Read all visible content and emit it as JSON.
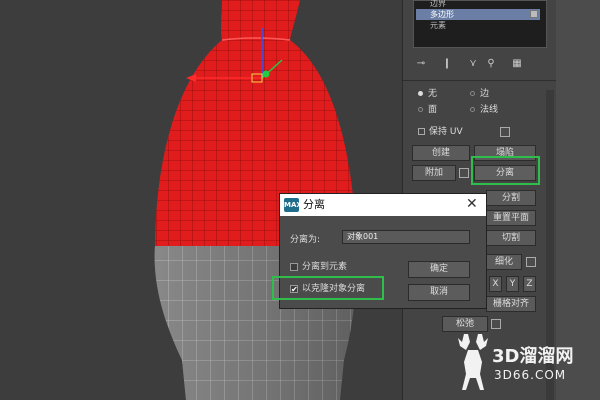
{
  "selection_list": {
    "items": [
      {
        "label": "边界"
      },
      {
        "label": "多边形",
        "active": true
      },
      {
        "label": "元素"
      }
    ]
  },
  "panel": {
    "radio_none": "无",
    "radio_edge": "边",
    "radio_face": "面",
    "radio_normal": "法线",
    "keep_uv": "保持 UV",
    "create": "创建",
    "collapse": "塌陷",
    "attach": "附加",
    "detach": "分离",
    "slice": "分割",
    "reset_plane": "重置平面",
    "cut": "切割",
    "refine": "细化",
    "axis_x": "X",
    "axis_y": "Y",
    "axis_z": "Z",
    "grid_align": "栅格对齐",
    "relax": "松弛"
  },
  "dialog": {
    "title": "分离",
    "detach_as_label": "分离为:",
    "detach_as_value": "对象001",
    "to_element_label": "分离到元素",
    "to_element_checked": false,
    "as_clone_label": "以克隆对象分离",
    "as_clone_checked": true,
    "ok_label": "确定",
    "cancel_label": "取消",
    "close_glyph": "✕"
  },
  "watermark": {
    "main": "3D溜溜网",
    "sub": "3D66.COM"
  },
  "colors": {
    "highlight": "#2fbd4b",
    "selected_mesh": "#e21b1b",
    "active_row": "#6b7fa6"
  },
  "icons": {
    "app_icon": "3ds-max-icon",
    "close": "close-icon"
  }
}
